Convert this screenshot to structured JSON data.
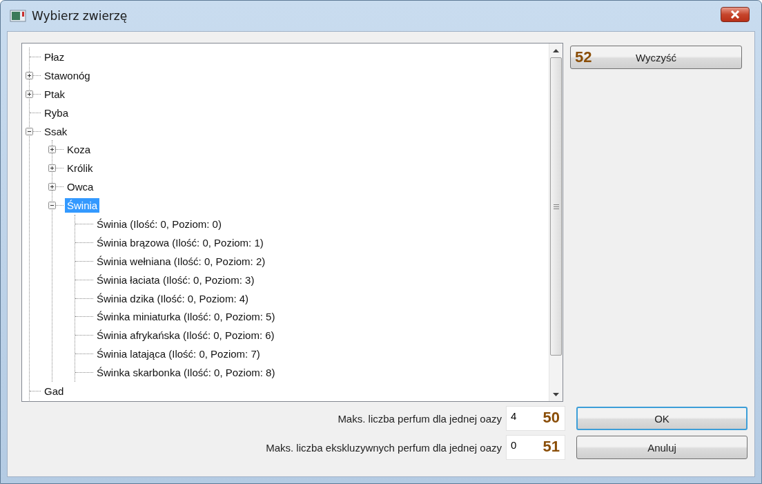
{
  "window": {
    "title": "Wybierz zwierzę"
  },
  "tree": {
    "nodes": [
      {
        "label": "Płaz",
        "selected": false
      },
      {
        "label": "Stawonóg",
        "expanded": false,
        "selected": false
      },
      {
        "label": "Ptak",
        "expanded": false,
        "selected": false
      },
      {
        "label": "Ryba",
        "selected": false
      },
      {
        "label": "Ssak",
        "expanded": true,
        "selected": false,
        "children": [
          {
            "label": "Koza",
            "expanded": false,
            "selected": false
          },
          {
            "label": "Królik",
            "expanded": false,
            "selected": false
          },
          {
            "label": "Owca",
            "expanded": false,
            "selected": false
          },
          {
            "label": "Świnia",
            "expanded": true,
            "selected": true,
            "children": [
              {
                "label": "Świnia (Ilość: 0, Poziom: 0)",
                "selected": false
              },
              {
                "label": "Świnia brązowa (Ilość: 0, Poziom: 1)",
                "selected": false
              },
              {
                "label": "Świnia wełniana (Ilość: 0, Poziom: 2)",
                "selected": false
              },
              {
                "label": "Świnia łaciata (Ilość: 0, Poziom: 3)",
                "selected": false
              },
              {
                "label": "Świnia dzika (Ilość: 0, Poziom: 4)",
                "selected": false
              },
              {
                "label": "Świnka miniaturka (Ilość: 0, Poziom: 5)",
                "selected": false
              },
              {
                "label": "Świnia afrykańska (Ilość: 0, Poziom: 6)",
                "selected": false
              },
              {
                "label": "Świnia latająca (Ilość: 0, Poziom: 7)",
                "selected": false
              },
              {
                "label": "Świnka skarbonka (Ilość: 0, Poziom: 8)",
                "selected": false
              }
            ]
          }
        ]
      },
      {
        "label": "Gad",
        "selected": false
      }
    ]
  },
  "clear_button": {
    "label": "Wyczyść",
    "badge": "52"
  },
  "fields": [
    {
      "label": "Maks. liczba perfum dla jednej oazy",
      "value": "4",
      "badge": "50"
    },
    {
      "label": "Maks. liczba ekskluzywnych perfum dla jednej oazy",
      "value": "0",
      "badge": "51"
    }
  ],
  "buttons": [
    {
      "label": "OK",
      "default": true
    },
    {
      "label": "Anuluj",
      "default": false
    }
  ]
}
